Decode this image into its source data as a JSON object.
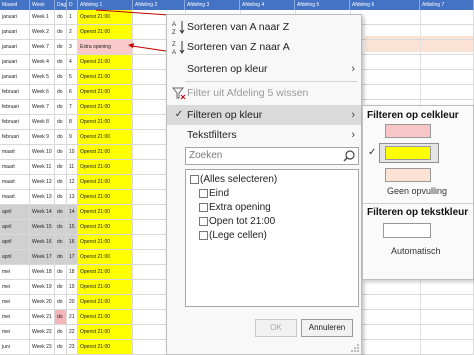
{
  "sheet": {
    "headers": [
      "Maand",
      "Week",
      "Dag",
      "D",
      "Afdeling 1",
      "Afdeling 2",
      "Afdeling 3",
      "Afdeling 4",
      "Afdeling 5",
      "Afdeling 6",
      "Afdeling 7"
    ],
    "rows": [
      {
        "month": "januari",
        "week": "Week 1",
        "day": "do",
        "num": "1",
        "open": "Openst 21:00"
      },
      {
        "month": "januari",
        "week": "Week 2",
        "day": "do",
        "num": "2",
        "open": "Openst 21:00"
      },
      {
        "month": "januari",
        "week": "Week 7",
        "day": "do",
        "num": "3",
        "open": "Extra opening"
      },
      {
        "month": "januari",
        "week": "Week 4",
        "day": "do",
        "num": "4",
        "open": "Openst 21:00"
      },
      {
        "month": "januari",
        "week": "Week 5",
        "day": "do",
        "num": "5",
        "open": "Openst 21:00"
      },
      {
        "month": "februari",
        "week": "Week 6",
        "day": "do",
        "num": "6",
        "open": "Openst 21:00"
      },
      {
        "month": "februari",
        "week": "Week 7",
        "day": "do",
        "num": "7",
        "open": "Openst 21:00"
      },
      {
        "month": "februari",
        "week": "Week 8",
        "day": "do",
        "num": "8",
        "open": "Openst 21:00"
      },
      {
        "month": "februari",
        "week": "Week 9",
        "day": "do",
        "num": "9",
        "open": "Openst 21:00"
      },
      {
        "month": "maart",
        "week": "Week 10",
        "day": "do",
        "num": "10",
        "open": "Openst 21:00"
      },
      {
        "month": "maart",
        "week": "Week 11",
        "day": "do",
        "num": "11",
        "open": "Openst 21:00"
      },
      {
        "month": "maart",
        "week": "Week 12",
        "day": "do",
        "num": "12",
        "open": "Openst 21:00"
      },
      {
        "month": "maart",
        "week": "Week 13",
        "day": "do",
        "num": "13",
        "open": "Openst 21:00"
      },
      {
        "month": "april",
        "week": "Week 14",
        "day": "do",
        "num": "14",
        "open": "Openst 21:00"
      },
      {
        "month": "april",
        "week": "Week 15",
        "day": "do",
        "num": "15",
        "open": "Openst 21:00"
      },
      {
        "month": "april",
        "week": "Week 16",
        "day": "do",
        "num": "16",
        "open": "Openst 21:00"
      },
      {
        "month": "april",
        "week": "Week 17",
        "day": "do",
        "num": "17",
        "open": "Openst 21:00"
      },
      {
        "month": "mei",
        "week": "Week 18",
        "day": "do",
        "num": "18",
        "open": "Openst 21:00"
      },
      {
        "month": "mei",
        "week": "Week 19",
        "day": "do",
        "num": "19",
        "open": "Openst 21:00"
      },
      {
        "month": "mei",
        "week": "Week 20",
        "day": "do",
        "num": "20",
        "open": "Openst 21:00"
      },
      {
        "month": "mei",
        "week": "Week 21",
        "day": "do",
        "num": "21",
        "open": "Openst 21:00"
      },
      {
        "month": "mei",
        "week": "Week 22",
        "day": "do",
        "num": "22",
        "open": "Openst 21:00"
      },
      {
        "month": "juni",
        "week": "Week 23",
        "day": "do",
        "num": "23",
        "open": "Openst 21:00"
      }
    ]
  },
  "menu": {
    "sort_az": "Sorteren van A naar Z",
    "sort_za": "Sorteren van Z naar A",
    "sort_color": "Sorteren op kleur",
    "clear_filter": "Filter uit Afdeling 5 wissen",
    "filter_color": "Filteren op kleur",
    "text_filters": "Tekstfilters",
    "search_placeholder": "Zoeken",
    "items": [
      "(Alles selecteren)",
      "Eind",
      "Extra opening",
      "Open tot 21:00",
      "(Lege cellen)"
    ],
    "ok": "OK",
    "cancel": "Annuleren"
  },
  "submenu": {
    "cell_color_title": "Filteren op celkleur",
    "no_fill": "Geen opvulling",
    "font_color_title": "Filteren op tekstkleur",
    "automatic": "Automatisch",
    "swatches": [
      "#f9c7c7",
      "#ffff00",
      "#fbe2d5",
      "#ffffff"
    ]
  },
  "colors": {
    "header_blue": "#4472c4",
    "highlight_yellow": "#ffff00",
    "annotation_red": "#c00000"
  }
}
